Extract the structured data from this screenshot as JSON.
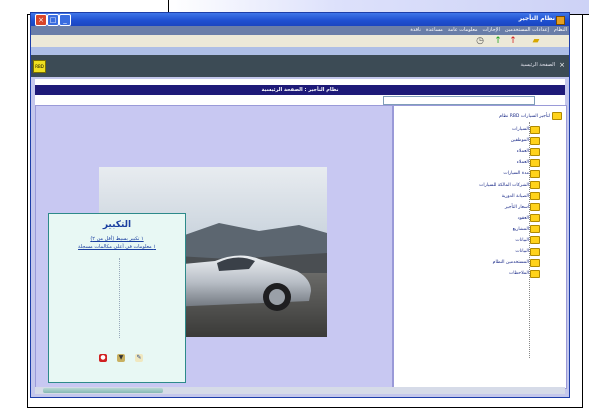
{
  "window": {
    "title": "نظام التأجير"
  },
  "menu": {
    "items": [
      "النظام",
      "إعدادات المستخدمين",
      "الإجازات",
      "معلومات عامة",
      "مساعدة",
      "نافذة"
    ]
  },
  "toolbar": {
    "icons": [
      "clock-icon",
      "green-arrow-icon",
      "red-arrow-icon",
      "folder-icon"
    ]
  },
  "breadcrumb": {
    "text": "الصفحة الرئيسية"
  },
  "header": {
    "title": "نظام التأجير : الصفحة الرئيسية"
  },
  "login": {
    "title": "التكبير",
    "link1": "١ تكبير بسيط (أقل من ٢)",
    "link2": "١ معلومات في أعلى مكالمات مسجلة"
  },
  "tree": {
    "root": "نظام RBD لتأجير السيارات",
    "items": [
      "السيارات",
      "الموظفين",
      "العملاء",
      "العملاء",
      "مدة السيارات",
      "الشركات المالكة للسيارات",
      "الصيانة الدورية",
      "أسعار التأجير",
      "العقود",
      "المشاريع",
      "البيانات",
      "البيانات",
      "المستخدمين النظام",
      "الملاحظات"
    ]
  },
  "colors": {
    "titlebar": "#1e4fd0",
    "header_bar": "#1e1a78",
    "main_bg": "#c8c8f2",
    "folder": "#ffd21a"
  }
}
